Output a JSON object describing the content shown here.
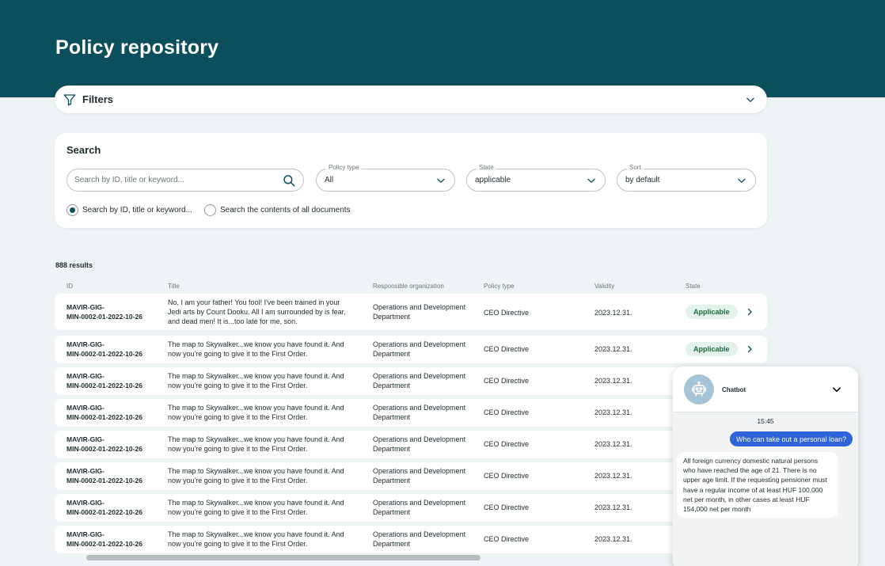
{
  "page": {
    "title": "Policy repository"
  },
  "filters": {
    "label": "Filters"
  },
  "search": {
    "title": "Search",
    "placeholder": "Search by ID, title or keyword...",
    "policy_type": {
      "label": "Policy type",
      "value": "All"
    },
    "state": {
      "label": "State",
      "value": "applicable"
    },
    "sort": {
      "label": "Sort",
      "value": "by default"
    },
    "radio_options": [
      {
        "label": "Search by ID, title or keyword...",
        "selected": true
      },
      {
        "label": "Search the contents of all documents",
        "selected": false
      }
    ]
  },
  "results": {
    "count_label": "888 results",
    "columns": [
      "ID",
      "Title",
      "Responsible organization",
      "Policy type",
      "Validity",
      "State"
    ],
    "rows": [
      {
        "id_line1": "MAVIR-GIG-",
        "id_line2": "MIN-0002-01-2022-10-26",
        "title_lines": [
          "No, I am your father! You fool! I've been trained in your",
          "Jedi arts by Count Dooku. All I am surrounded by is fear,",
          "and dead men! It is...too late for me, son."
        ],
        "org_lines": [
          "Operations and Development",
          "Department"
        ],
        "policy_type": "CEO Directive",
        "validity": "2023.12.31.",
        "state": "Applicable"
      },
      {
        "id_line1": "MAVIR-GIG-",
        "id_line2": "MIN-0002-01-2022-10-26",
        "title_lines": [
          "The map to Skywalker...we know you have found it. And",
          "now you're going to give it to the First Order."
        ],
        "org_lines": [
          "Operations and Development",
          "Department"
        ],
        "policy_type": "CEO Directive",
        "validity": "2023.12.31.",
        "state": "Applicable"
      },
      {
        "id_line1": "MAVIR-GIG-",
        "id_line2": "MIN-0002-01-2022-10-26",
        "title_lines": [
          "The map to Skywalker...we know you have found it. And",
          "now you're going to give it to the First Order."
        ],
        "org_lines": [
          "Operations and Development",
          "Department"
        ],
        "policy_type": "CEO Directive",
        "validity": "2023.12.31.",
        "state": ""
      },
      {
        "id_line1": "MAVIR-GIG-",
        "id_line2": "MIN-0002-01-2022-10-26",
        "title_lines": [
          "The map to Skywalker...we know you have found it. And",
          "now you're going to give it to the First Order."
        ],
        "org_lines": [
          "Operations and Development",
          "Department"
        ],
        "policy_type": "CEO Directive",
        "validity": "2023.12.31.",
        "state": ""
      },
      {
        "id_line1": "MAVIR-GIG-",
        "id_line2": "MIN-0002-01-2022-10-26",
        "title_lines": [
          "The map to Skywalker...we know you have found it. And",
          "now you're going to give it to the First Order."
        ],
        "org_lines": [
          "Operations and Development",
          "Department"
        ],
        "policy_type": "CEO Directive",
        "validity": "2023.12.31.",
        "state": ""
      },
      {
        "id_line1": "MAVIR-GIG-",
        "id_line2": "MIN-0002-01-2022-10-26",
        "title_lines": [
          "The map to Skywalker...we know you have found it. And",
          "now you're going to give it to the First Order."
        ],
        "org_lines": [
          "Operations and Development",
          "Department"
        ],
        "policy_type": "CEO Directive",
        "validity": "2023.12.31.",
        "state": ""
      },
      {
        "id_line1": "MAVIR-GIG-",
        "id_line2": "MIN-0002-01-2022-10-26",
        "title_lines": [
          "The map to Skywalker...we know you have found it. And",
          "now you're going to give it to the First Order."
        ],
        "org_lines": [
          "Operations and Development",
          "Department"
        ],
        "policy_type": "CEO Directive",
        "validity": "2023.12.31.",
        "state": ""
      },
      {
        "id_line1": "MAVIR-GIG-",
        "id_line2": "MIN-0002-01-2022-10-26",
        "title_lines": [
          "The map to Skywalker...we know you have found it. And",
          "now you're going to give it to the First Order."
        ],
        "org_lines": [
          "Operations and Development",
          "Department"
        ],
        "policy_type": "CEO Directive",
        "validity": "2023.12.31.",
        "state": ""
      }
    ]
  },
  "chatbot": {
    "name": "Chatbot",
    "time": "15:45",
    "user_message": "Who can take out a personal loan?",
    "bot_message": "All foreign currency domestic natural persons who have reached the age of 21. There is no upper age limit. If the requesting pensioner must have a regular income of at least HUF 100,000 net per month, in other cases at least HUF 154,000 net per month"
  },
  "colors": {
    "brand": "#0b4f5c",
    "accent_blue": "#2f63d9",
    "badge_bg": "#e4f3ea",
    "badge_text": "#1d6b3e"
  },
  "icons": [
    "filter-icon",
    "chevron-down-icon",
    "search-icon",
    "chevron-right-icon",
    "robot-icon"
  ]
}
